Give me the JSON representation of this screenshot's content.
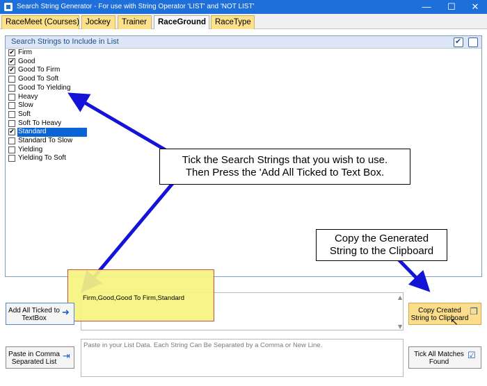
{
  "window": {
    "title": "Search String Generator - For use with String Operator 'LIST' and 'NOT LIST'",
    "minimize": "—",
    "maximize": "☐",
    "close": "✕"
  },
  "tabs": [
    {
      "label": "RaceMeet (Courses)",
      "active": false
    },
    {
      "label": "Jockey",
      "active": false
    },
    {
      "label": "Trainer",
      "active": false
    },
    {
      "label": "RaceGround",
      "active": true
    },
    {
      "label": "RaceType",
      "active": false
    }
  ],
  "group": {
    "title": "Search Strings to Include in List"
  },
  "check_items": [
    {
      "label": "Firm",
      "checked": true,
      "selected": false
    },
    {
      "label": "Good",
      "checked": true,
      "selected": false
    },
    {
      "label": "Good To Firm",
      "checked": true,
      "selected": false
    },
    {
      "label": "Good To Soft",
      "checked": false,
      "selected": false
    },
    {
      "label": "Good To Yielding",
      "checked": false,
      "selected": false
    },
    {
      "label": "Heavy",
      "checked": false,
      "selected": false
    },
    {
      "label": "Slow",
      "checked": false,
      "selected": false
    },
    {
      "label": "Soft",
      "checked": false,
      "selected": false
    },
    {
      "label": "Soft To Heavy",
      "checked": false,
      "selected": false
    },
    {
      "label": "Standard",
      "checked": true,
      "selected": true
    },
    {
      "label": "Standard To Slow",
      "checked": false,
      "selected": false
    },
    {
      "label": "Yielding",
      "checked": false,
      "selected": false
    },
    {
      "label": "Yielding To Soft",
      "checked": false,
      "selected": false
    }
  ],
  "callouts": {
    "main_line1": "Tick the Search Strings that you wish to use.",
    "main_line2": "Then Press the 'Add All Ticked to Text Box.",
    "copy_line1": "Copy the Generated",
    "copy_line2": "String to the Clipboard"
  },
  "buttons": {
    "add_line1": "Add All Ticked to",
    "add_line2": "TextBox",
    "paste_line1": "Paste in Comma",
    "paste_line2": "Separated List",
    "copy_line1": "Copy Created",
    "copy_line2": "String to Clipboard",
    "tick_line1": "Tick All Matches",
    "tick_line2": "Found"
  },
  "output": {
    "value": "Firm,Good,Good To Firm,Standard"
  },
  "paste_box": {
    "placeholder": "Paste in your List Data. Each String Can Be Separated by a Comma or New Line."
  },
  "colors": {
    "titlebar": "#1e6fd9",
    "tab_inactive": "#fde08a",
    "selection": "#0a64d6",
    "arrow": "#1414d8",
    "highlight": "#f7f580",
    "copy_button": "#fbdd8b"
  },
  "icons": {
    "check": "✔",
    "add_arrow": "➜",
    "paste": "⇥",
    "copy": "❐",
    "tick_box": "☑"
  }
}
